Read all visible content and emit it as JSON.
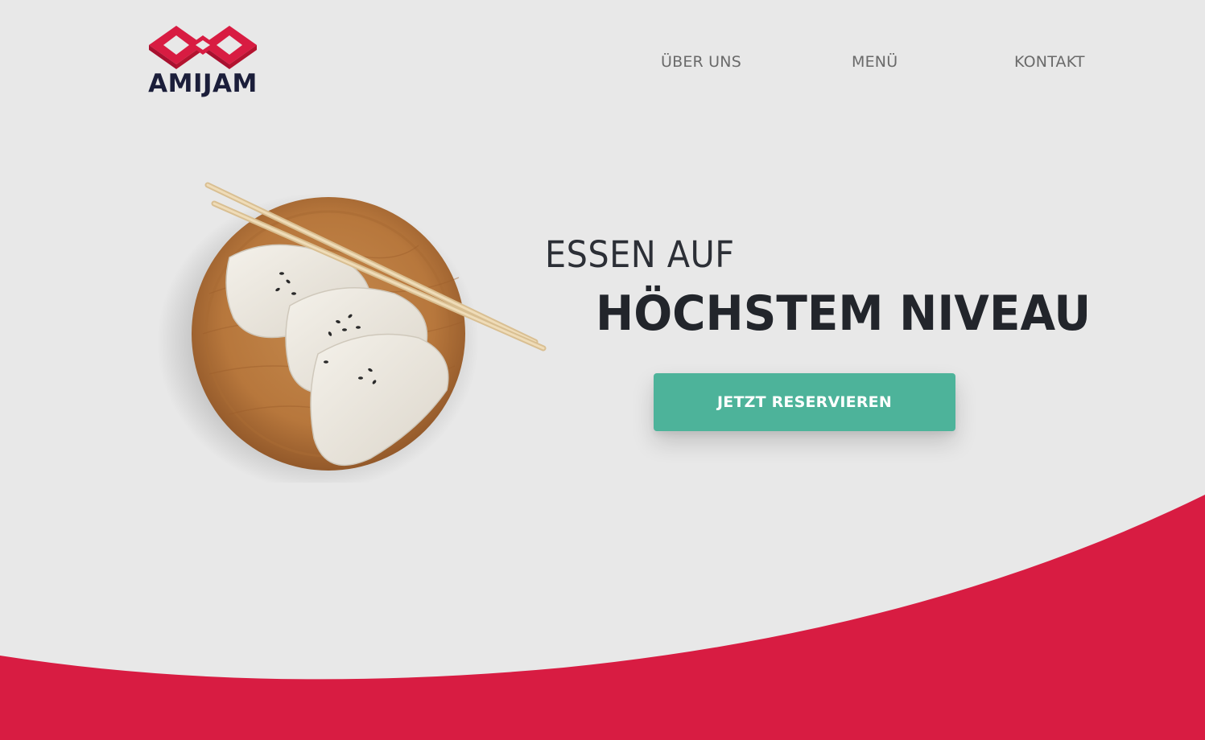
{
  "header": {
    "brand_name": "AMIJAM",
    "brand_color": "#d81c42",
    "nav": [
      {
        "label": "ÜBER UNS"
      },
      {
        "label": "MENÜ"
      },
      {
        "label": "KONTAKT"
      }
    ]
  },
  "hero": {
    "headline_line1": "ESSEN AUF",
    "headline_line2": "HÖCHSTEM NIVEAU",
    "cta_label": "JETZT RESERVIEREN",
    "cta_color": "#4db39a",
    "image_icon": "dumplings-on-wooden-plate-with-chopsticks"
  },
  "theme": {
    "background": "#e8e8e8",
    "accent": "#d81c42",
    "text_dark": "#22252b",
    "nav_text": "#6a6a6a"
  }
}
